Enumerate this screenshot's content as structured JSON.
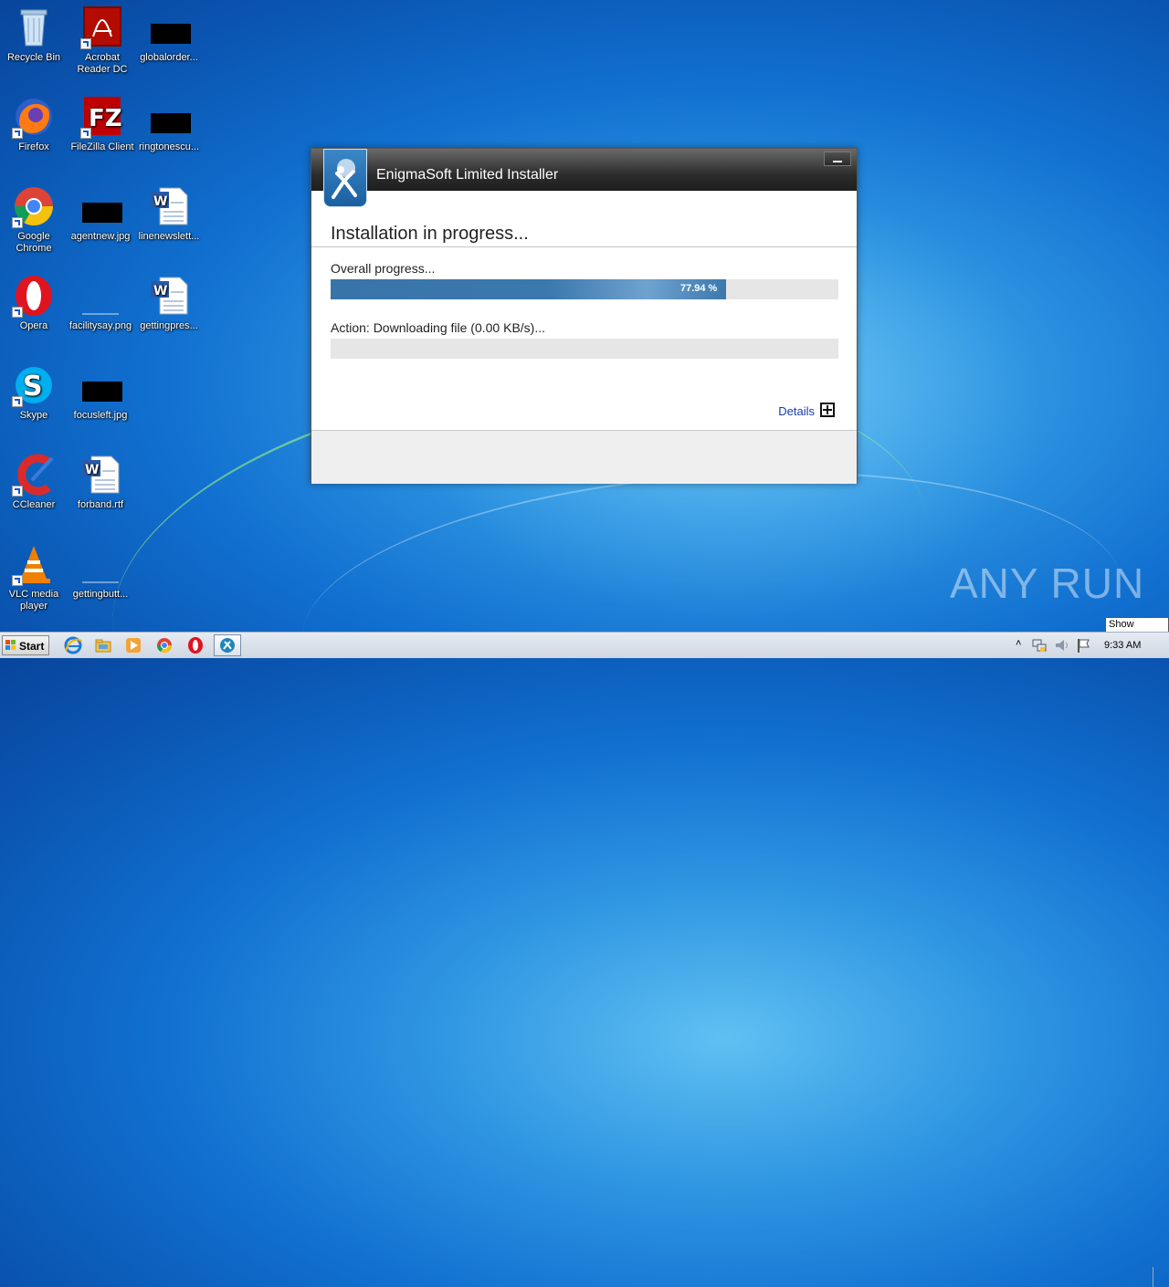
{
  "desktop": {
    "icons": [
      {
        "label": "Recycle Bin"
      },
      {
        "label": "Acrobat\nReader DC"
      },
      {
        "label": "globalorder..."
      },
      {
        "label": "Firefox"
      },
      {
        "label": "FileZilla Client"
      },
      {
        "label": "ringtonescu..."
      },
      {
        "label": "Google\nChrome"
      },
      {
        "label": "agentnew.jpg"
      },
      {
        "label": "linenewslett..."
      },
      {
        "label": "Opera"
      },
      {
        "label": "facilitysay.png"
      },
      {
        "label": "gettingpres..."
      },
      {
        "label": "Skype"
      },
      {
        "label": "focusleft.jpg"
      },
      {
        "label": "CCleaner"
      },
      {
        "label": "forband.rtf"
      },
      {
        "label": "VLC media\nplayer"
      },
      {
        "label": "gettingbutt..."
      }
    ]
  },
  "installer": {
    "title": "EnigmaSoft Limited Installer",
    "heading": "Installation in progress...",
    "overall_label": "Overall progress...",
    "overall_percent_text": "77.94 %",
    "overall_progress": 0.7794,
    "action_label": "Action: Downloading file (0.00 KB/s)...",
    "action_progress": 0,
    "details_label": "Details"
  },
  "watermark": "ANY RUN",
  "taskbar": {
    "start_label": "Start",
    "clock": "9:33 AM",
    "show_desktop_tooltip": "Show desktop"
  },
  "colors": {
    "progress_fill": "#3b78ad",
    "details_link": "#1a3aa8"
  }
}
